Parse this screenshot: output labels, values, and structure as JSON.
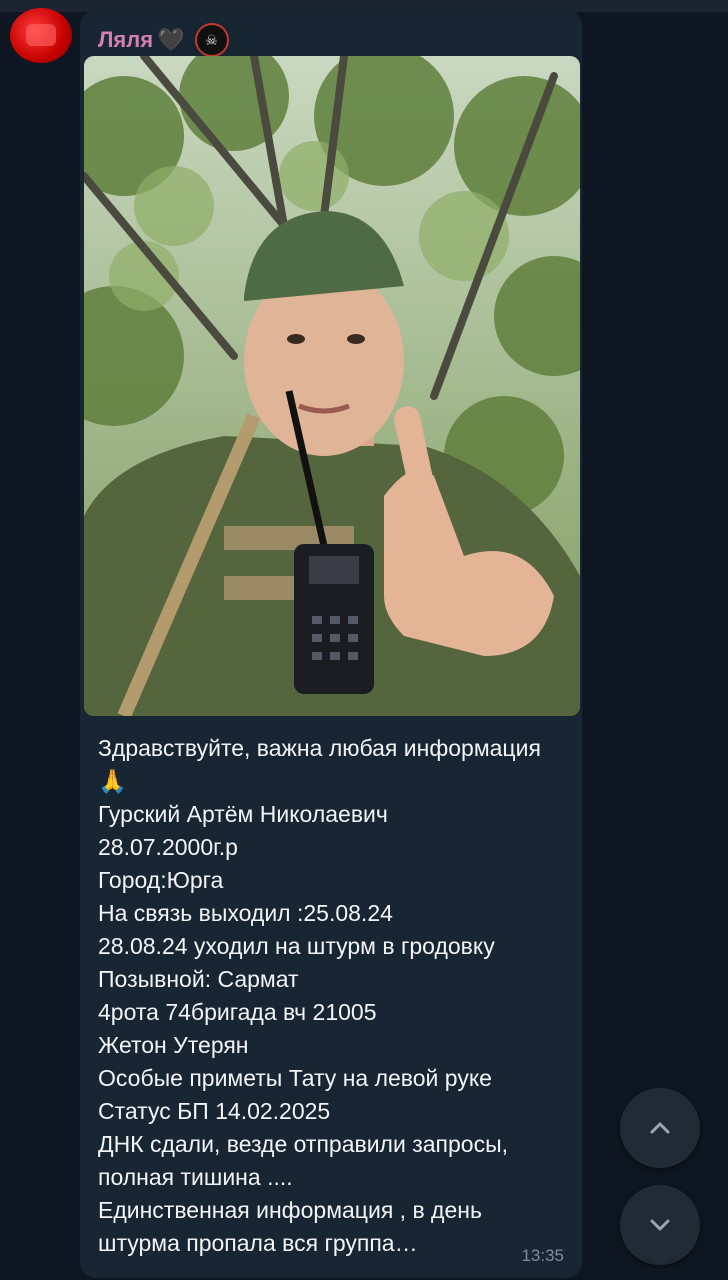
{
  "sender": {
    "name": "Ляля",
    "heart": "🖤",
    "badge_icon": "skull-emblem-icon"
  },
  "message": {
    "text": "Здравствуйте, важна любая информация 🙏\nГурский Артём Николаевич\n28.07.2000г.р\nГород:Юрга\nНа связь выходил :25.08.24\n28.08.24 уходил на штурм в гродовку\nПозывной: Сармат\n4рота 74бригада вч 21005\nЖетон Утерян\nОсобые приметы Тату на левой руке\nСтатус БП 14.02.2025\nДНК сдали, везде отправили запросы, полная тишина ....\nЕдинственная информация , в день штурма пропала вся группа…",
    "time": "13:35"
  },
  "colors": {
    "background": "#0e1621",
    "bubble": "#182533",
    "sender_name": "#d57fb4",
    "text": "#f2f4f6",
    "time": "#7f8c99"
  },
  "nav": {
    "up_icon": "chevron-up-icon",
    "down_icon": "chevron-down-icon"
  }
}
